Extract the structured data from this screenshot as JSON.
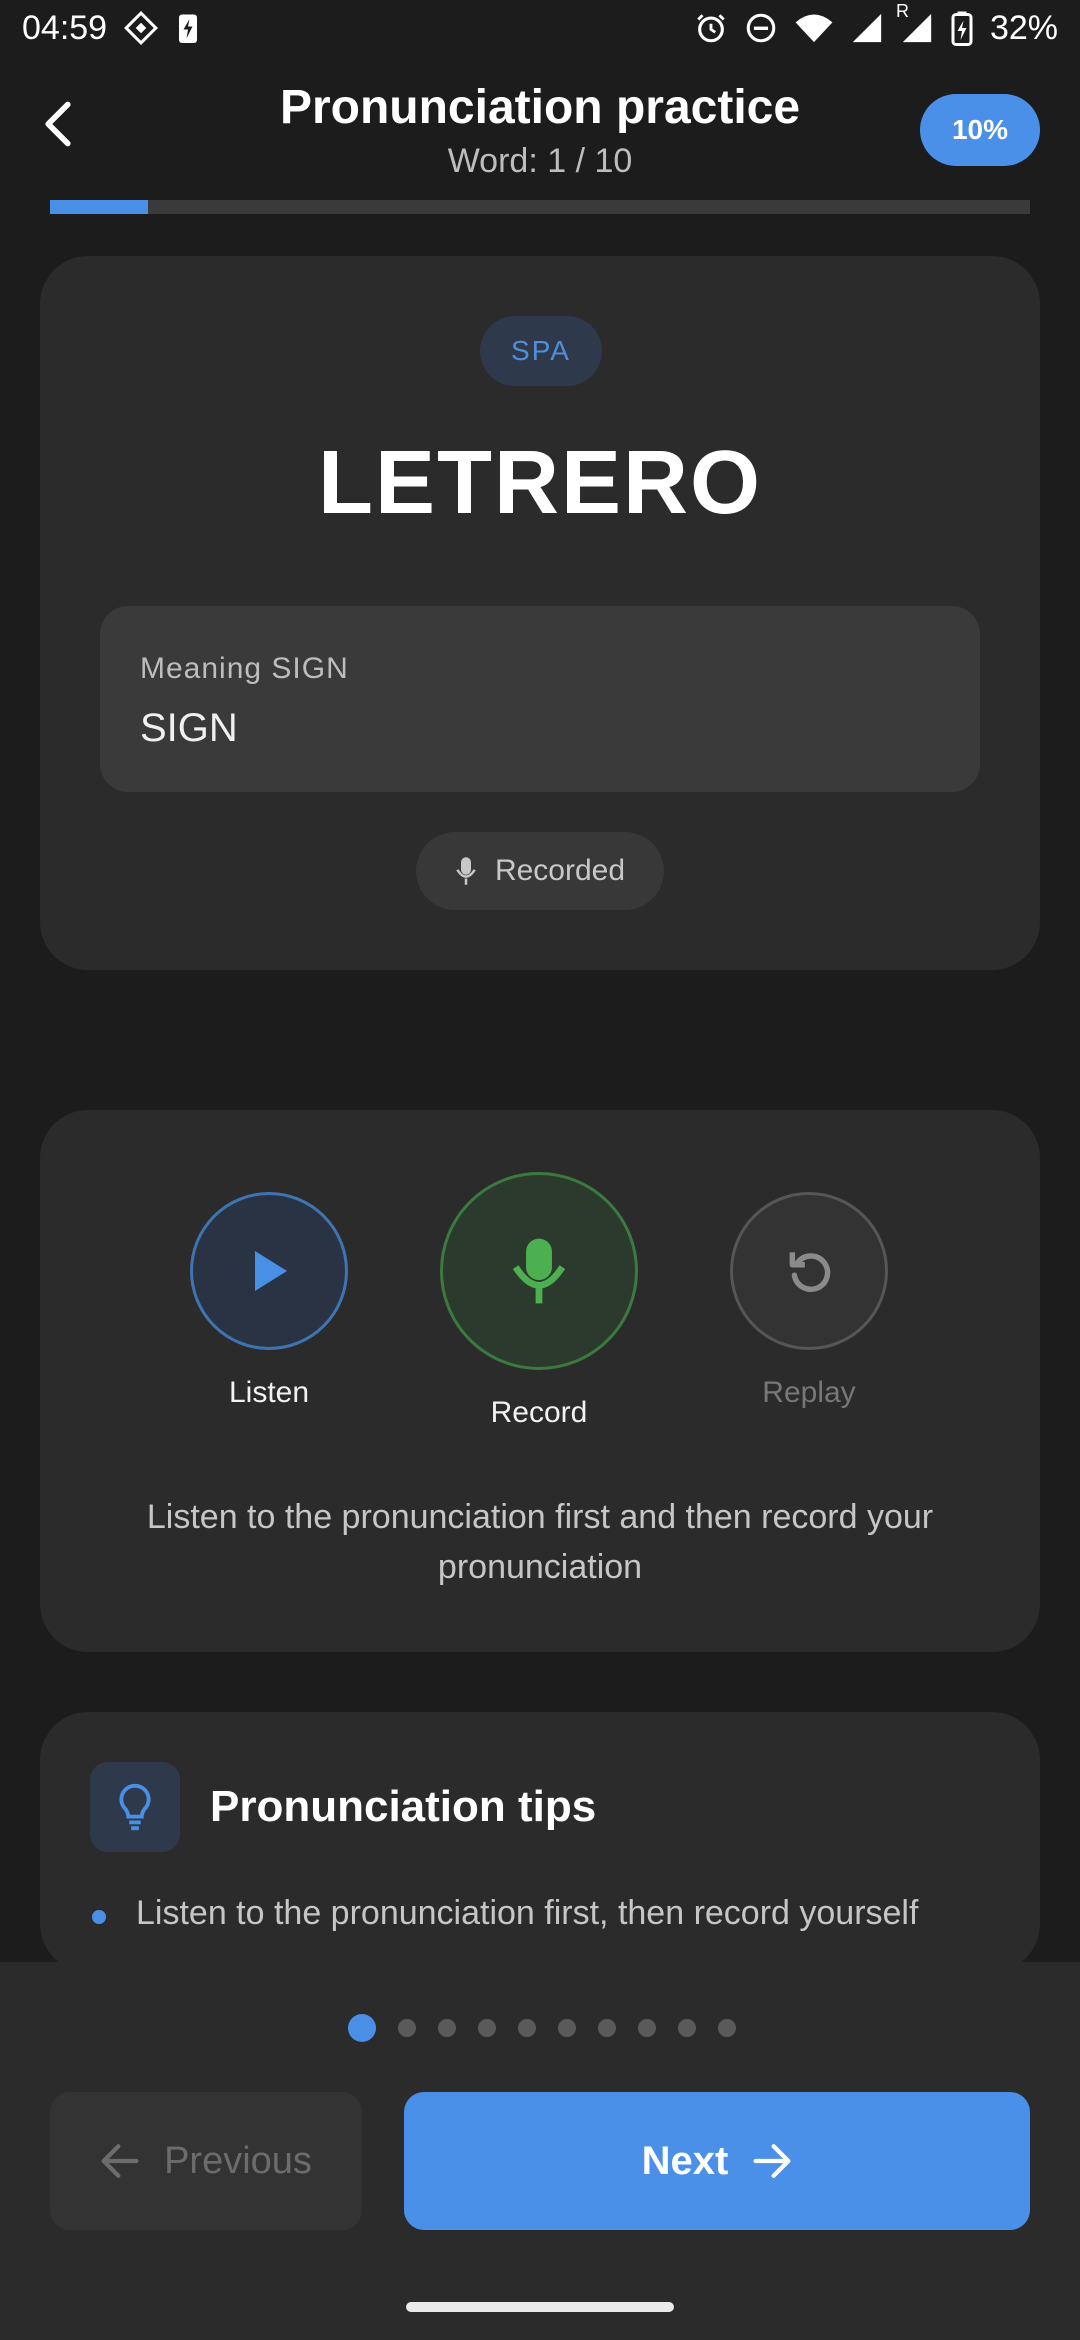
{
  "status_bar": {
    "time": "04:59",
    "battery": "32%",
    "roaming_mark": "R"
  },
  "header": {
    "title": "Pronunciation practice",
    "subtitle": "Word: 1 / 10",
    "progress_badge": "10%",
    "progress_fraction": 0.1
  },
  "word_card": {
    "language": "SPA",
    "word": "LETRERO",
    "meaning_label": "Meaning SIGN",
    "meaning_value": "SIGN",
    "recorded_label": "Recorded"
  },
  "controls": {
    "listen_label": "Listen",
    "record_label": "Record",
    "replay_label": "Replay",
    "hint": "Listen to the pronunciation first and then record your pronunciation"
  },
  "tips": {
    "title": "Pronunciation tips",
    "items": [
      "Listen to the pronunciation first, then record yourself"
    ]
  },
  "pager": {
    "total": 10,
    "current": 1
  },
  "nav": {
    "previous_label": "Previous",
    "next_label": "Next"
  },
  "colors": {
    "accent": "#4a90e8",
    "record_green": "#4caf50",
    "background": "#1c1c1c",
    "card": "#2b2b2b"
  }
}
